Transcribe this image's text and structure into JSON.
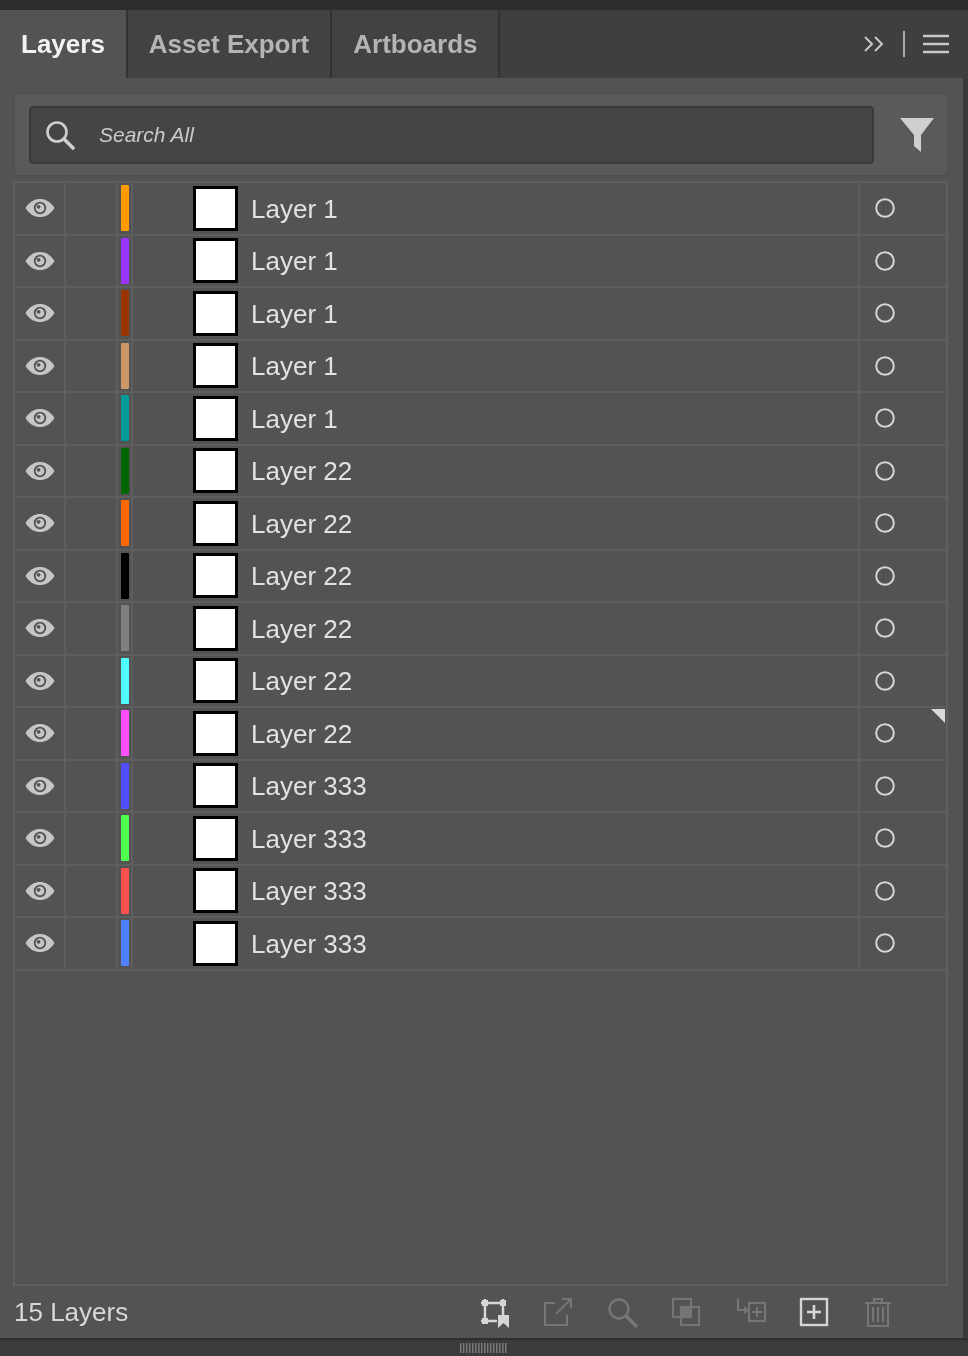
{
  "tabs": [
    {
      "label": "Layers",
      "selected": true
    },
    {
      "label": "Asset Export",
      "selected": false
    },
    {
      "label": "Artboards",
      "selected": false
    }
  ],
  "search": {
    "placeholder": "Search All"
  },
  "layers": [
    {
      "name": "Layer 1",
      "visible": true,
      "color": "#ff9900",
      "current": false
    },
    {
      "name": "Layer 1",
      "visible": true,
      "color": "#9933ff",
      "current": false
    },
    {
      "name": "Layer 1",
      "visible": true,
      "color": "#993300",
      "current": false
    },
    {
      "name": "Layer 1",
      "visible": true,
      "color": "#cc9966",
      "current": false
    },
    {
      "name": "Layer 1",
      "visible": true,
      "color": "#009999",
      "current": false
    },
    {
      "name": "Layer 22",
      "visible": true,
      "color": "#006600",
      "current": false
    },
    {
      "name": "Layer 22",
      "visible": true,
      "color": "#ff6600",
      "current": false
    },
    {
      "name": "Layer 22",
      "visible": true,
      "color": "#000000",
      "current": false
    },
    {
      "name": "Layer 22",
      "visible": true,
      "color": "#808080",
      "current": false
    },
    {
      "name": "Layer 22",
      "visible": true,
      "color": "#4fffff",
      "current": false
    },
    {
      "name": "Layer 22",
      "visible": true,
      "color": "#ff4fff",
      "current": true
    },
    {
      "name": "Layer 333",
      "visible": true,
      "color": "#4f4fff",
      "current": false
    },
    {
      "name": "Layer 333",
      "visible": true,
      "color": "#4fff4f",
      "current": false
    },
    {
      "name": "Layer 333",
      "visible": true,
      "color": "#ff4f4f",
      "current": false
    },
    {
      "name": "Layer 333",
      "visible": true,
      "color": "#4f80ff",
      "current": false
    }
  ],
  "footer": {
    "count": "15 Layers",
    "buttons": [
      {
        "kind": "collect",
        "disabled": false
      },
      {
        "kind": "export",
        "disabled": true
      },
      {
        "kind": "locate",
        "disabled": true
      },
      {
        "kind": "mask",
        "disabled": true
      },
      {
        "kind": "move",
        "disabled": true
      },
      {
        "kind": "new_layer",
        "disabled": false
      },
      {
        "kind": "delete",
        "disabled": true
      }
    ]
  }
}
